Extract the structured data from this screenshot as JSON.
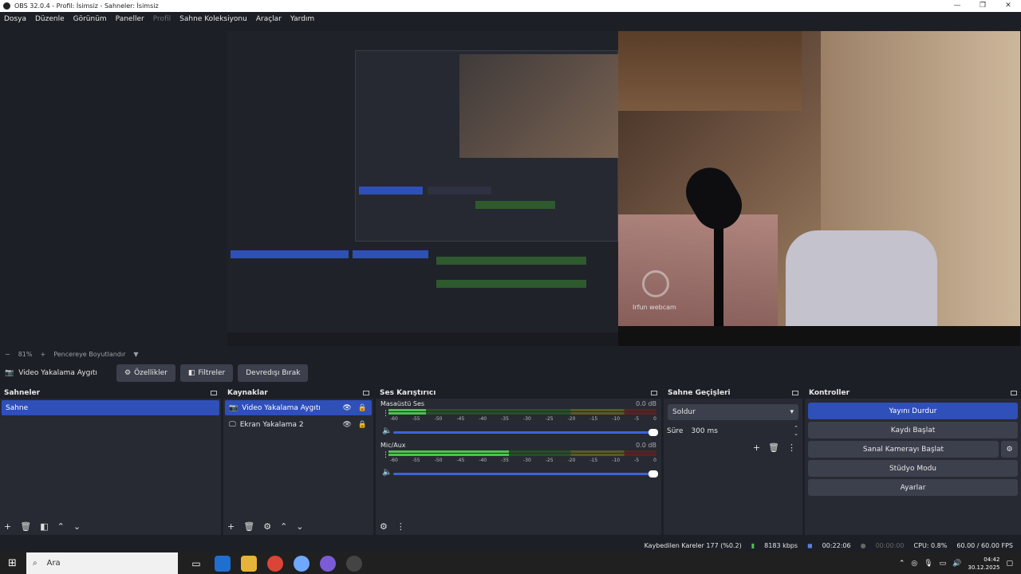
{
  "window": {
    "title": "OBS 32.0.4 - Profil: İsimsiz - Sahneler: İsimsiz"
  },
  "menu": [
    "Dosya",
    "Düzenle",
    "Görünüm",
    "Paneller",
    "Profil",
    "Sahne Koleksiyonu",
    "Araçlar",
    "Yardım"
  ],
  "preview": {
    "webcam_label": "Irfun webcam"
  },
  "zoom": {
    "minus": "−",
    "value": "81%",
    "plus": "+",
    "fit": "Pencereye Boyutlandır"
  },
  "source_toolbar": {
    "source_name": "Video Yakalama Aygıtı",
    "properties": "Özellikler",
    "filters": "Filtreler",
    "deactivate": "Devredışı Bırak"
  },
  "scenes": {
    "title": "Sahneler",
    "items": [
      "Sahne"
    ]
  },
  "sources": {
    "title": "Kaynaklar",
    "items": [
      "Video Yakalama Aygıtı",
      "Ekran Yakalama 2"
    ]
  },
  "mixer": {
    "title": "Ses Karıştırıcı",
    "ticks": [
      "-60",
      "-55",
      "-50",
      "-45",
      "-40",
      "-35",
      "-30",
      "-25",
      "-20",
      "-15",
      "-10",
      "-5",
      "0"
    ],
    "channels": [
      {
        "name": "Masaüstü Ses",
        "db": "0.0 dB",
        "level": 0.14
      },
      {
        "name": "Mic/Aux",
        "db": "0.0 dB",
        "level": 0.45
      }
    ]
  },
  "transitions": {
    "title": "Sahne Geçişleri",
    "type": "Soldur",
    "duration_label": "Süre",
    "duration_value": "300 ms"
  },
  "controls": {
    "title": "Kontroller",
    "stop_stream": "Yayını Durdur",
    "start_record": "Kaydı Başlat",
    "start_virtualcam": "Sanal Kamerayı Başlat",
    "studio_mode": "Stüdyo Modu",
    "settings": "Ayarlar"
  },
  "status": {
    "dropped": "Kaybedilen Kareler 177 (%0.2)",
    "bitrate": "8183 kbps",
    "stream_time": "00:22:06",
    "record_time": "00:00:00",
    "cpu": "CPU: 0.8%",
    "fps": "60.00 / 60.00 FPS"
  },
  "taskbar": {
    "search": "Ara",
    "time": "04:42",
    "date": "30.12.2025"
  },
  "colors": {
    "accent": "#2f4fb9",
    "meter_green": "#4fc24f",
    "panel": "#272a33",
    "bg": "#1d1f26"
  }
}
